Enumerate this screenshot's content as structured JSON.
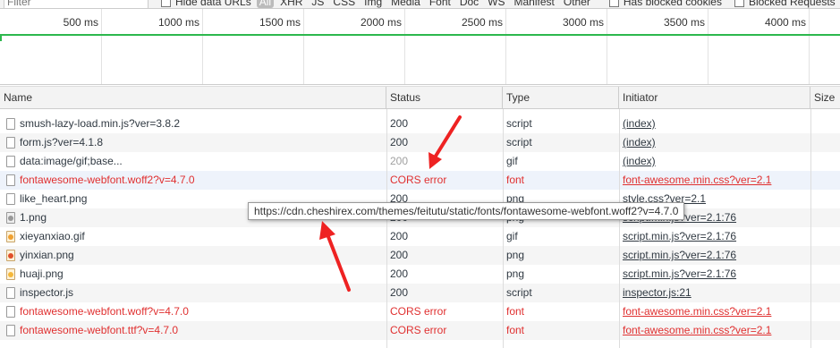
{
  "filterbar": {
    "filter_placeholder": "Filter",
    "hide_data_urls_label": "Hide data URLs",
    "types": [
      "All",
      "XHR",
      "JS",
      "CSS",
      "Img",
      "Media",
      "Font",
      "Doc",
      "WS",
      "Manifest",
      "Other"
    ],
    "has_blocked_cookies_label": "Has blocked cookies",
    "blocked_requests_label": "Blocked Requests"
  },
  "overview": {
    "ticks": [
      "500 ms",
      "1000 ms",
      "1500 ms",
      "2000 ms",
      "2500 ms",
      "3000 ms",
      "3500 ms",
      "4000 ms"
    ],
    "colors": {
      "timeline": "#2db84d"
    }
  },
  "columns": {
    "name": "Name",
    "status": "Status",
    "type": "Type",
    "initiator": "Initiator",
    "size": "Size"
  },
  "rows": [
    {
      "name": "smush-lazy-load.min.js?ver=3.8.2",
      "status": "200",
      "type": "script",
      "initiator": "(index)",
      "icon": "file-icon",
      "state": "ok"
    },
    {
      "name": "form.js?ver=4.1.8",
      "status": "200",
      "type": "script",
      "initiator": "(index)",
      "icon": "file-icon",
      "state": "ok"
    },
    {
      "name": "data:image/gif;base...",
      "status": "200",
      "type": "gif",
      "initiator": "(index)",
      "icon": "file-icon",
      "state": "gray"
    },
    {
      "name": "fontawesome-webfont.woff2?v=4.7.0",
      "status": "CORS error",
      "type": "font",
      "initiator": "font-awesome.min.css?ver=2.1",
      "icon": "file-icon",
      "state": "error"
    },
    {
      "name": "like_heart.png",
      "status": "200",
      "type": "png",
      "initiator": "style.css?ver=2.1",
      "icon": "file-icon",
      "state": "ok"
    },
    {
      "name": "1.png",
      "status": "200",
      "type": "png",
      "initiator": "script.min.js?ver=2.1:76",
      "icon": "image-icon",
      "state": "ok"
    },
    {
      "name": "xieyanxiao.gif",
      "status": "200",
      "type": "gif",
      "initiator": "script.min.js?ver=2.1:76",
      "icon": "gif-icon",
      "state": "ok"
    },
    {
      "name": "yinxian.png",
      "status": "200",
      "type": "png",
      "initiator": "script.min.js?ver=2.1:76",
      "icon": "png-icon",
      "state": "ok"
    },
    {
      "name": "huaji.png",
      "status": "200",
      "type": "png",
      "initiator": "script.min.js?ver=2.1:76",
      "icon": "png-icon",
      "state": "ok"
    },
    {
      "name": "inspector.js",
      "status": "200",
      "type": "script",
      "initiator": "inspector.js:21",
      "icon": "file-icon",
      "state": "ok"
    },
    {
      "name": "fontawesome-webfont.woff?v=4.7.0",
      "status": "CORS error",
      "type": "font",
      "initiator": "font-awesome.min.css?ver=2.1",
      "icon": "file-icon",
      "state": "error"
    },
    {
      "name": "fontawesome-webfont.ttf?v=4.7.0",
      "status": "CORS error",
      "type": "font",
      "initiator": "font-awesome.min.css?ver=2.1",
      "icon": "file-icon",
      "state": "error"
    }
  ],
  "tooltip": {
    "url": "https://cdn.cheshirex.com/themes/feitutu/static/fonts/fontawesome-webfont.woff2?v=4.7.0"
  },
  "annotation_colors": {
    "arrow": "#ee2222"
  }
}
